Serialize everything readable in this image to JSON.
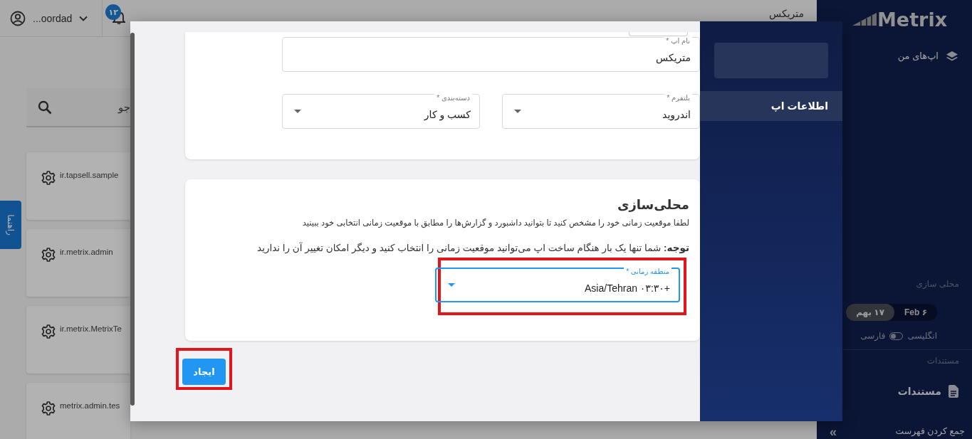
{
  "sidebar": {
    "logo": "Metrix",
    "items": [
      {
        "kind": "link",
        "label": "اپ‌های من"
      }
    ],
    "localization": {
      "heading": "محلی سازی",
      "dates": [
        {
          "label": "Feb ۶",
          "selected": false
        },
        {
          "label": "۱۷ بهم",
          "selected": true
        }
      ],
      "language": {
        "labels": [
          "انگلیسی",
          "فارسی"
        ],
        "on": false
      }
    },
    "docs": {
      "heading": "مستندات",
      "item": "مستندات"
    },
    "collapse": {
      "icon": "»",
      "label": "جمع کردن فهرست"
    }
  },
  "topbar": {
    "title": "متریکس",
    "notifications": "۱۲",
    "user": "...oordad"
  },
  "search": {
    "placeholder": "جو"
  },
  "apps": [
    {
      "package": "ir.tapsell.sample"
    },
    {
      "package": "ir.metrix.admin"
    },
    {
      "package": "ir.metrix.MetrixTe"
    },
    {
      "package": "metrix.admin.tes"
    }
  ],
  "help_tab": "راهنما",
  "modal": {
    "nav": [
      {
        "label": "اطلاعات اپ",
        "selected": true
      }
    ],
    "fields": [
      {
        "kind": "text",
        "label": "نام اپ *",
        "value": "متریکس",
        "focused": false
      },
      {
        "kind": "select",
        "label": "پلتفرم *",
        "value": "اندروید",
        "focused": false
      },
      {
        "kind": "select",
        "label": "دسته‌بندی *",
        "value": "کسب و کار",
        "focused": false
      }
    ],
    "localization": {
      "title": "محلی‌سازی",
      "description": "لطفا موقعیت زمانی خود را مشخص کنید تا بتوانید داشبورد و گزارش‌ها را مطابق با موقعیت زمانی انتخابی خود ببینید",
      "note": "**توجه:** شما تنها یک بار هنگام ساخت اپ می‌توانید موقعیت زمانی را انتخاب کنید و دیگر امکان تغییر آن را ندارید",
      "field": {
        "kind": "select",
        "label": "منطقه زمانی *",
        "value": "Asia/Tehran ۰۳:۳۰+",
        "focused": true,
        "highlighted": true
      }
    },
    "submit": {
      "label": "ایجاد",
      "highlighted": true
    }
  }
}
